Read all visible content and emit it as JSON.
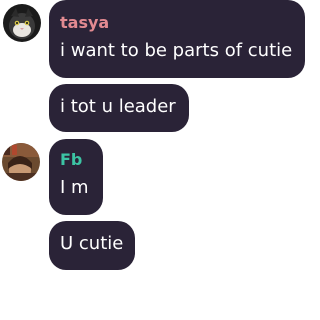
{
  "messages": [
    {
      "sender": "tasya",
      "sender_color": "#e28a91",
      "avatar": "cat-avatar",
      "text": "i want to be parts of cutie"
    },
    {
      "text": "i tot u leader"
    },
    {
      "sender": "Fb",
      "sender_color": "#3cc4a4",
      "avatar": "portrait-avatar",
      "text": "I m"
    },
    {
      "text": "U cutie"
    }
  ],
  "colors": {
    "bubble": "#2a2337",
    "text": "#ffffff",
    "background": "#ffffff"
  }
}
